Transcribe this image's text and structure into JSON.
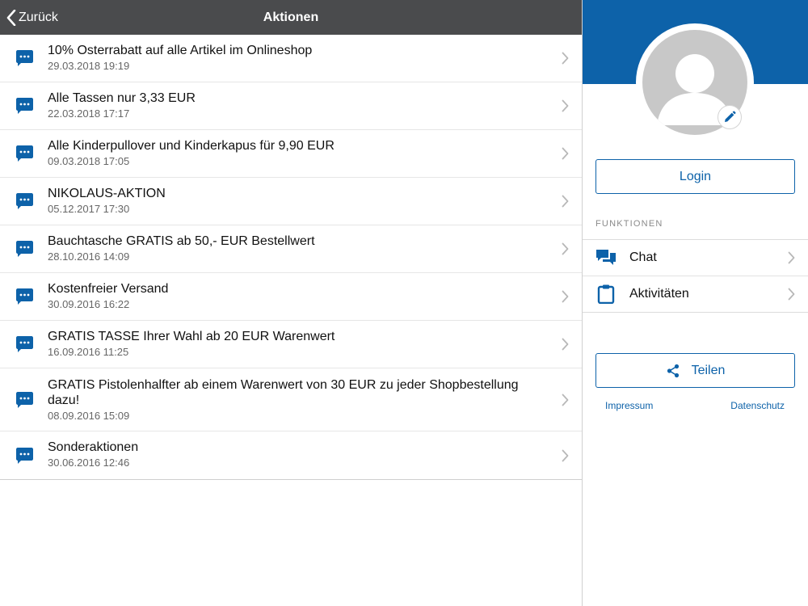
{
  "navbar": {
    "back_label": "Zurück",
    "title": "Aktionen"
  },
  "actions": [
    {
      "title": "10% Osterrabatt auf alle Artikel im Onlineshop",
      "date": "29.03.2018 19:19"
    },
    {
      "title": "Alle Tassen nur 3,33 EUR",
      "date": "22.03.2018 17:17"
    },
    {
      "title": "Alle Kinderpullover und Kinderkapus für 9,90 EUR",
      "date": "09.03.2018 17:05"
    },
    {
      "title": "NIKOLAUS-AKTION",
      "date": "05.12.2017 17:30"
    },
    {
      "title": "Bauchtasche GRATIS ab 50,- EUR Bestellwert",
      "date": "28.10.2016 14:09"
    },
    {
      "title": "Kostenfreier Versand",
      "date": "30.09.2016 16:22"
    },
    {
      "title": "GRATIS TASSE Ihrer Wahl ab 20 EUR Warenwert",
      "date": "16.09.2016 11:25"
    },
    {
      "title": "GRATIS Pistolenhalfter ab einem Warenwert von 30 EUR zu jeder Shopbestellung dazu!",
      "date": "08.09.2016 15:09"
    },
    {
      "title": "Sonderaktionen",
      "date": "30.06.2016 12:46"
    }
  ],
  "sidebar": {
    "login_label": "Login",
    "section_label": "FUNKTIONEN",
    "functions": [
      {
        "label": "Chat",
        "icon": "chat-bubbles-icon"
      },
      {
        "label": "Aktivitäten",
        "icon": "clipboard-icon"
      }
    ],
    "share_label": "Teilen",
    "impressum_label": "Impressum",
    "datenschutz_label": "Datenschutz"
  },
  "colors": {
    "navbar_bg": "#4a4b4d",
    "accent_blue": "#0d62a9",
    "avatar_gray": "#c8c8c8"
  }
}
